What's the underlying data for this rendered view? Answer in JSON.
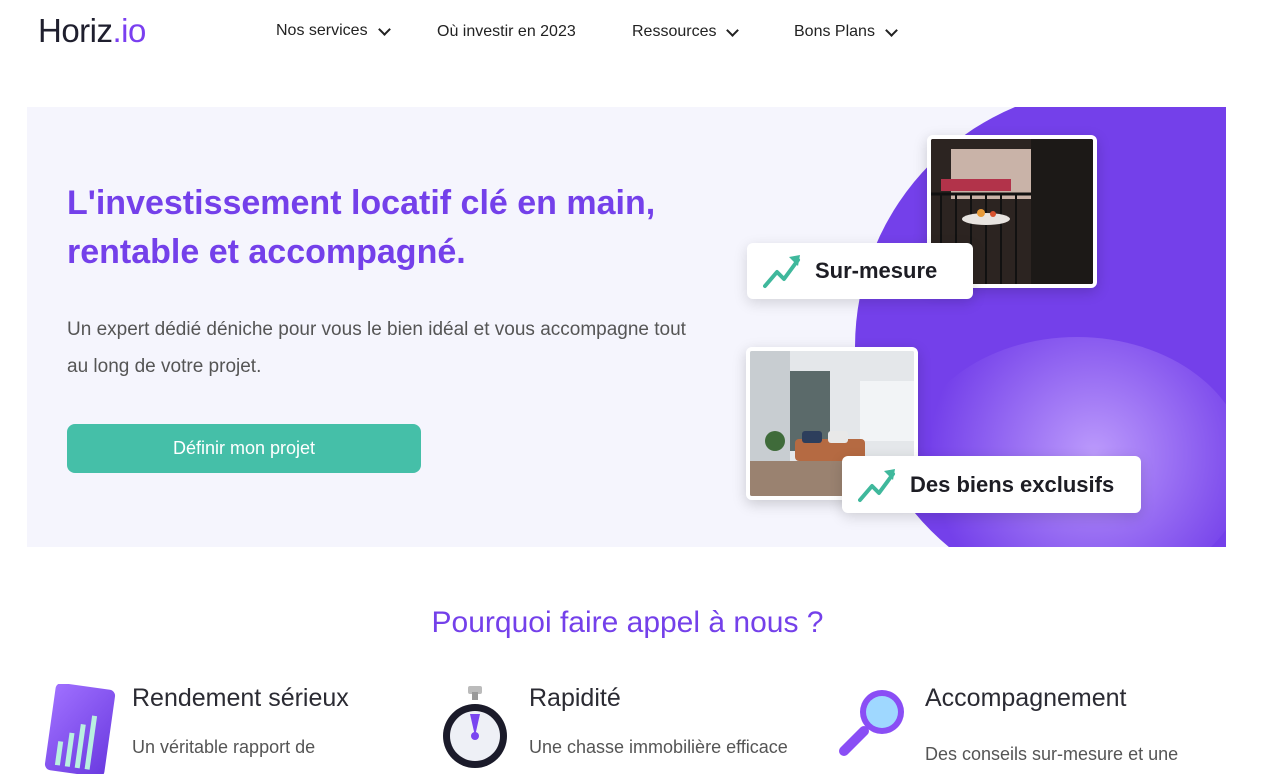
{
  "header": {
    "logo_main": "Horiz",
    "logo_dot": ".io",
    "nav": [
      {
        "label": "Nos services",
        "dropdown": true
      },
      {
        "label": "Où investir en 2023",
        "dropdown": false
      },
      {
        "label": "Ressources",
        "dropdown": true
      },
      {
        "label": "Bons Plans",
        "dropdown": true
      }
    ]
  },
  "hero": {
    "title": "L'investissement locatif clé en main, rentable et accompagné.",
    "subtitle": "Un expert dédié déniche pour vous le bien idéal et vous accompagne tout au long de votre projet.",
    "cta_label": "Définir mon projet",
    "badge1": "Sur-mesure",
    "badge2": "Des biens exclusifs",
    "photo1_alt": "balcony-photo",
    "photo2_alt": "living-room-photo"
  },
  "why": {
    "title": "Pourquoi faire appel à nous ?",
    "features": [
      {
        "title": "Rendement sérieux",
        "text": "Un véritable rapport de",
        "icon": "chart-document-icon"
      },
      {
        "title": "Rapidité",
        "text": "Une chasse immobilière efficace",
        "icon": "stopwatch-icon"
      },
      {
        "title": "Accompagnement",
        "text": "Des conseils sur-mesure et une",
        "icon": "magnifier-icon"
      }
    ]
  },
  "colors": {
    "accent": "#7440ea",
    "cta": "#45bfa8",
    "hero_bg": "#f5f5fd",
    "trend_arrow": "#3fb89c"
  }
}
